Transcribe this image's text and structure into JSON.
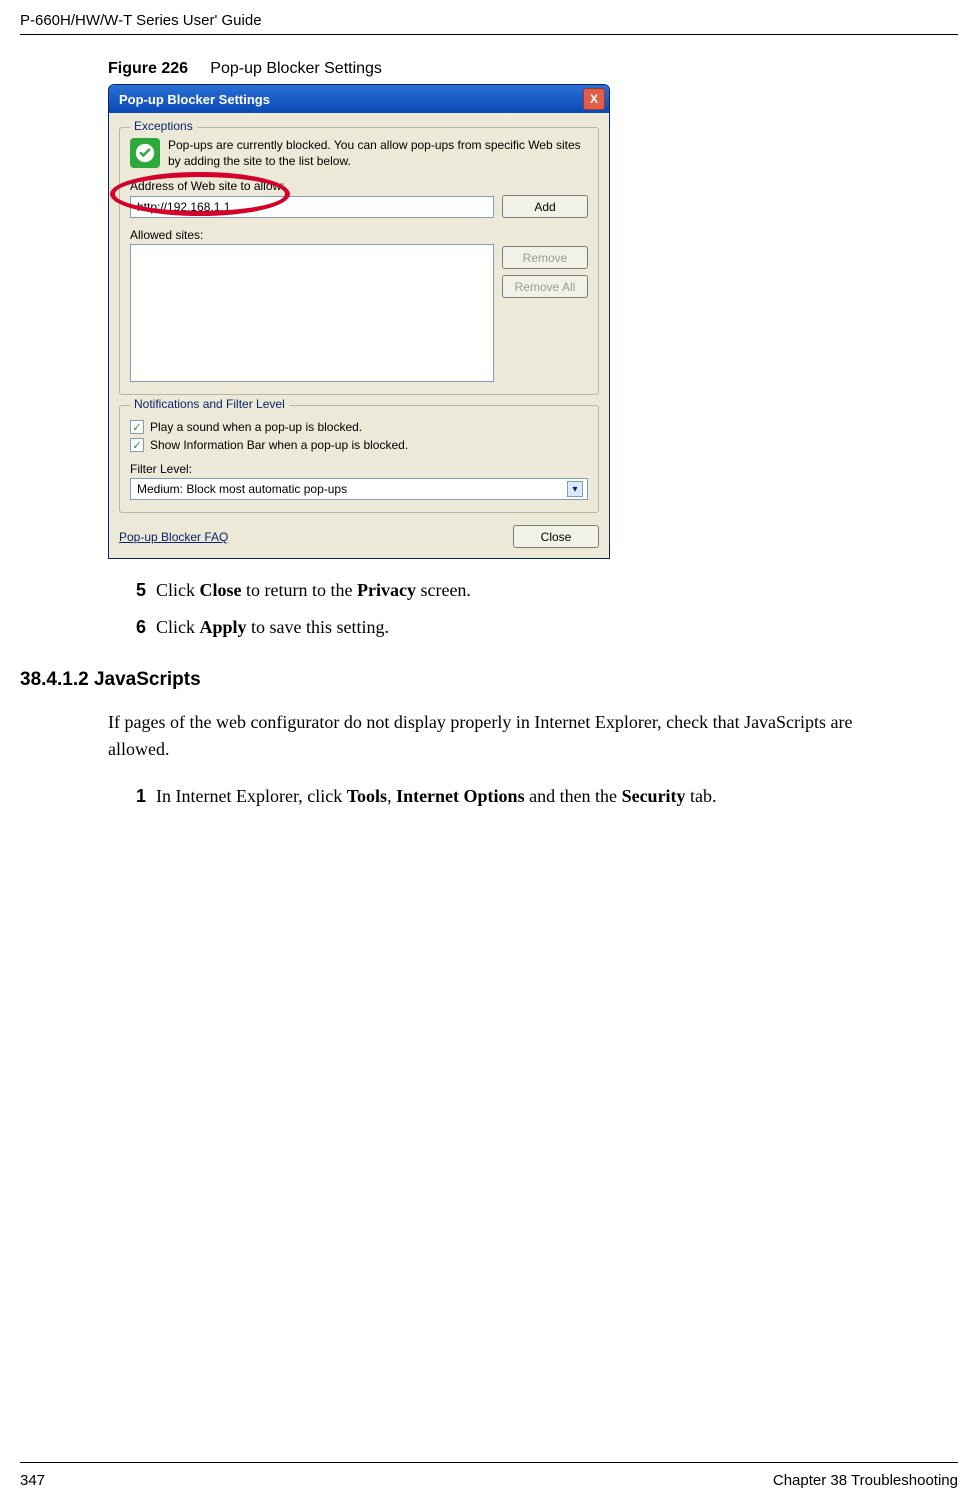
{
  "header": {
    "title": "P-660H/HW/W-T Series User' Guide"
  },
  "figure": {
    "label": "Figure 226",
    "title": "Pop-up Blocker Settings"
  },
  "dialog": {
    "title": "Pop-up Blocker Settings",
    "close_glyph": "X",
    "exceptions": {
      "legend": "Exceptions",
      "info_text": "Pop-ups are currently blocked.  You can allow pop-ups from specific Web sites by adding the site to the list below.",
      "address_label": "Address of Web site to allow:",
      "address_value": "http://192.168.1.1",
      "add_label": "Add",
      "allowed_label": "Allowed sites:",
      "remove_label": "Remove",
      "remove_all_label": "Remove All"
    },
    "notifications": {
      "legend": "Notifications and Filter Level",
      "play_sound_label": "Play a sound when a pop-up is blocked.",
      "show_info_bar_label": "Show Information Bar when a pop-up is blocked.",
      "filter_level_label": "Filter Level:",
      "filter_level_value": "Medium: Block most automatic pop-ups"
    },
    "faq_label": "Pop-up Blocker FAQ",
    "close_label": "Close"
  },
  "steps_after_figure": {
    "s5": {
      "num": "5",
      "pre": "Click ",
      "b1": "Close",
      "mid": " to return to the ",
      "b2": "Privacy",
      "post": " screen."
    },
    "s6": {
      "num": "6",
      "pre": "Click ",
      "b1": "Apply",
      "post": " to save this setting."
    }
  },
  "section": {
    "number_title": "38.4.1.2  JavaScripts",
    "para": "If pages of the web configurator do not display properly in Internet Explorer, check that JavaScripts are allowed.",
    "step1": {
      "num": "1",
      "pre": "In Internet Explorer, click ",
      "b1": "Tools",
      "c1": ", ",
      "b2": "Internet Options",
      "c2": " and then the ",
      "b3": "Security",
      "post": " tab."
    }
  },
  "footer": {
    "page": "347",
    "chapter": "Chapter 38 Troubleshooting"
  }
}
